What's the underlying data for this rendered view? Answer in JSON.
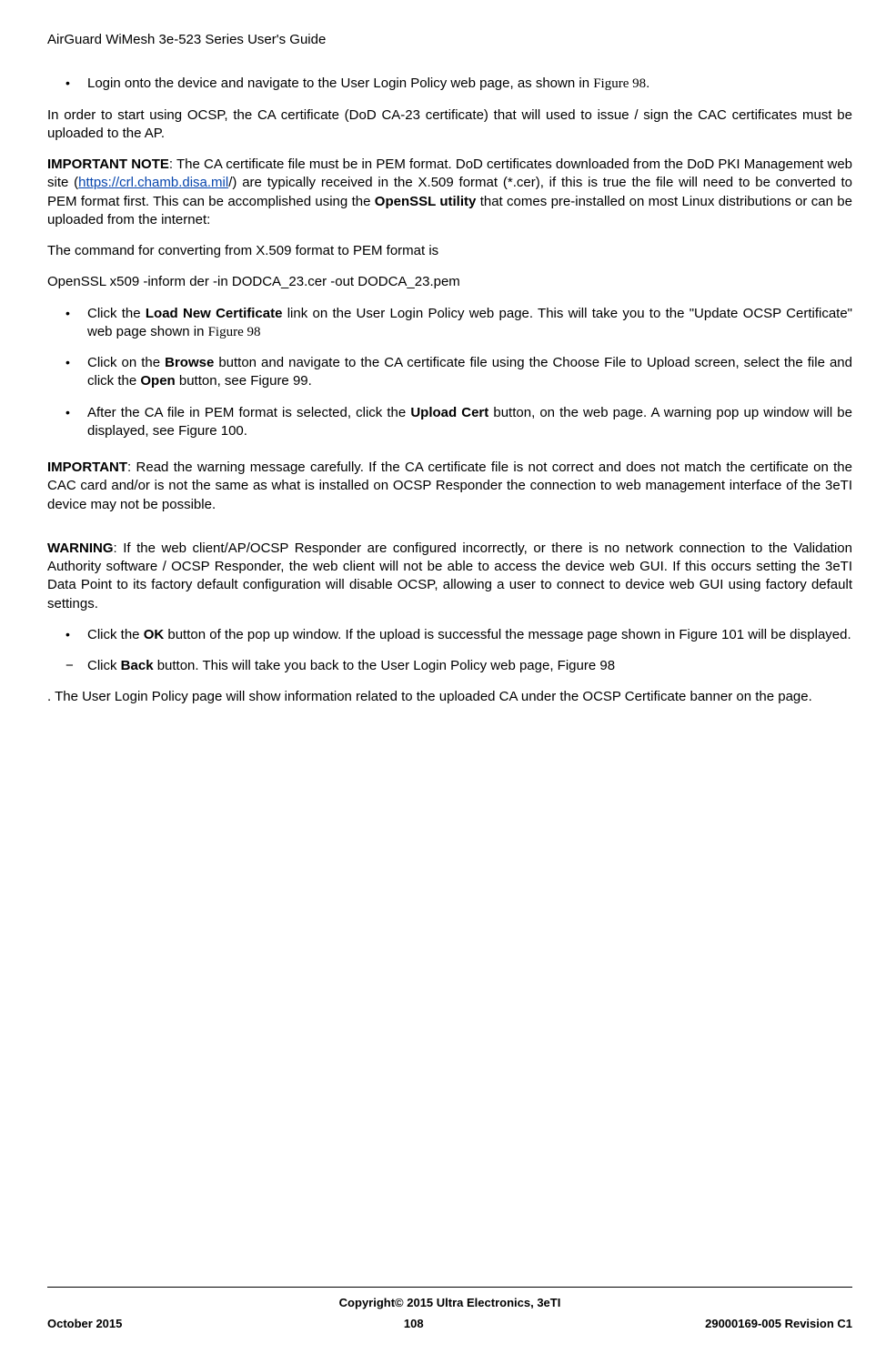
{
  "header": {
    "title": "AirGuard WiMesh 3e-523 Series User's Guide"
  },
  "body": {
    "bullets1": [
      {
        "pre": "Login onto the device and navigate to the User Login Policy web page, as shown in ",
        "link": "Figure 98",
        "post": "."
      }
    ],
    "p1": "In order to start using OCSP, the CA certificate (DoD CA-23 certificate) that will used to issue / sign the CAC certificates must be uploaded to the AP.",
    "p2": {
      "lead": "IMPORTANT NOTE",
      "seg1": ": The CA certificate file must be in PEM format. DoD certificates downloaded from the DoD PKI Management web site (",
      "url": "https://crl.chamb.disa.mil",
      "seg2": "/) are typically received in the X.509 format (*.cer), if this is true the file will need to be converted to PEM format first. This can be accomplished using the ",
      "bold": "OpenSSL utility",
      "seg3": " that comes pre-installed on most Linux distributions or can be uploaded from the internet:"
    },
    "p3": "The command for converting from X.509 format to PEM format is",
    "p4": "OpenSSL x509 -inform der -in DODCA_23.cer -out DODCA_23.pem",
    "bullets2": [
      {
        "pre": "Click the ",
        "b1": "Load New Certificate",
        "mid": " link on the User Login Policy web page. This will take you to the \"Update OCSP Certificate\" web page shown in ",
        "ref": "Figure 98"
      },
      {
        "pre": "Click on the ",
        "b1": "Browse",
        "mid": " button and navigate to the CA certificate file using the Choose File to Upload screen, select the file and click the ",
        "b2": "Open",
        "post": " button, see Figure 99."
      },
      {
        "pre": "After the CA file in PEM format is selected, click the ",
        "b1": "Upload Cert",
        "post": " button, on the web page. A warning pop up window will be displayed, see Figure 100."
      }
    ],
    "p_important": {
      "lead": "IMPORTANT",
      "text": ": Read the warning message carefully. If the CA certificate file is not correct and does not match the certificate on the CAC card and/or is not the same as what is installed on OCSP Responder the connection to web management interface of the 3eTI device may not be possible."
    },
    "p_warning": {
      "lead": "WARNING",
      "text": ": If the web client/AP/OCSP Responder are configured incorrectly, or there is no network connection to the Validation Authority software / OCSP Responder, the web client will not be able to access the device web GUI. If this occurs setting the 3eTI Data Point to its factory default configuration will disable OCSP, allowing a user to connect to device web GUI using factory default settings."
    },
    "bullets3": [
      {
        "pre": "Click the ",
        "b1": "OK",
        "post": " button of the pop up window. If the upload is successful the message page shown in Figure 101 will be displayed."
      }
    ],
    "dash1": [
      {
        "pre": "Click ",
        "b1": "Back",
        "post": " button. This will take you back to the User Login Policy web page, Figure 98"
      }
    ],
    "p_last": ". The User Login Policy page will show information related to the uploaded CA under the OCSP Certificate banner on the page."
  },
  "footer": {
    "copyright": "Copyright© 2015 Ultra Electronics, 3eTI",
    "left": "October 2015",
    "center": "108",
    "right": "29000169-005 Revision C1"
  }
}
